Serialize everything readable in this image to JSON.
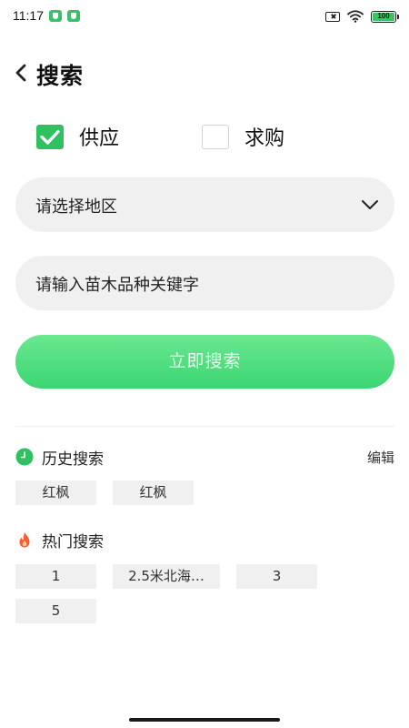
{
  "status_bar": {
    "time": "11:17",
    "battery": "100",
    "icons": [
      "app-shield-icon",
      "app-shield-icon",
      "sim-x-icon",
      "wifi-icon",
      "battery-icon"
    ]
  },
  "header": {
    "back_icon": "chevron-left-icon",
    "title": "搜索"
  },
  "type_options": [
    {
      "label": "供应",
      "checked": true
    },
    {
      "label": "求购",
      "checked": false
    }
  ],
  "region_select": {
    "placeholder": "请选择地区",
    "icon": "chevron-down-icon"
  },
  "keyword_input": {
    "placeholder": "请输入苗木品种关键字"
  },
  "search_button": {
    "label": "立即搜索"
  },
  "history": {
    "icon": "clock-icon",
    "title": "历史搜索",
    "edit_label": "编辑",
    "tags": [
      "红枫",
      "红枫"
    ]
  },
  "hot": {
    "icon": "fire-icon",
    "title": "热门搜索",
    "tags": [
      "1",
      "2.5米北海…",
      "3",
      "5"
    ]
  },
  "colors": {
    "accent": "#2fc160",
    "button_gradient_top": "#6ae88f",
    "button_gradient_bottom": "#3cd573",
    "fire": "#ff5a2a",
    "field_bg": "#f0f0f0"
  }
}
